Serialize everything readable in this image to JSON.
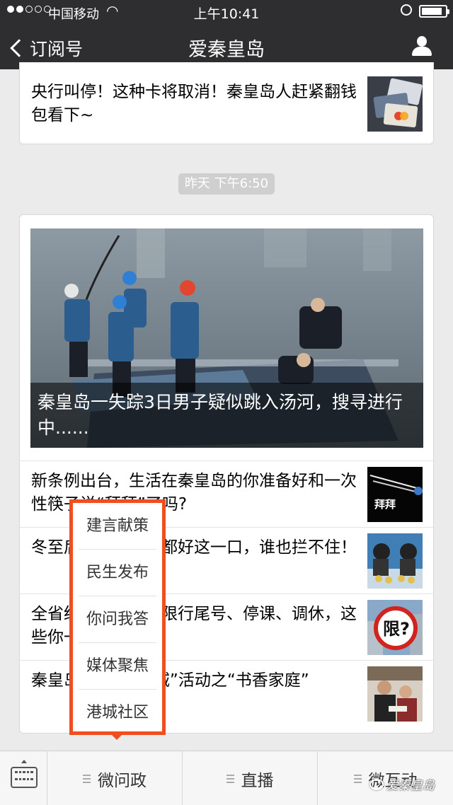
{
  "status_bar": {
    "carrier": "中国移动",
    "time": "上午10:41"
  },
  "nav": {
    "back_label": "订阅号",
    "title": "爱秦皇岛"
  },
  "articles_top": [
    {
      "title": "央行叫停！这种卡将取消！秦皇岛人赶紧翻钱包看下~"
    }
  ],
  "timestamp": "昨天 下午6:50",
  "cover_article": {
    "title": "秦皇岛一失踪3日男子疑似跳入汤河，搜寻进行中......"
  },
  "articles": [
    {
      "title": "新条例出台，生活在秦皇岛的你准备好和一次性筷子说“拜拜”了吗?",
      "thumb_text": "拜拜"
    },
    {
      "title": "冬至后，秦皇岛人都好这一口，谁也拦不住！"
    },
    {
      "title": "全省统一！秦皇岛限行尾号、停课、调休，这些你一定要知道~",
      "thumb_text": "限?"
    },
    {
      "title": "秦皇岛：“书香港城”活动之“书香家庭”"
    }
  ],
  "popup_menu": [
    "建言献策",
    "民生发布",
    "你问我答",
    "媒体聚焦",
    "港城社区"
  ],
  "bottom_menu": [
    "微问政",
    "直播",
    "微互动"
  ],
  "watermark": "爱秦皇岛"
}
